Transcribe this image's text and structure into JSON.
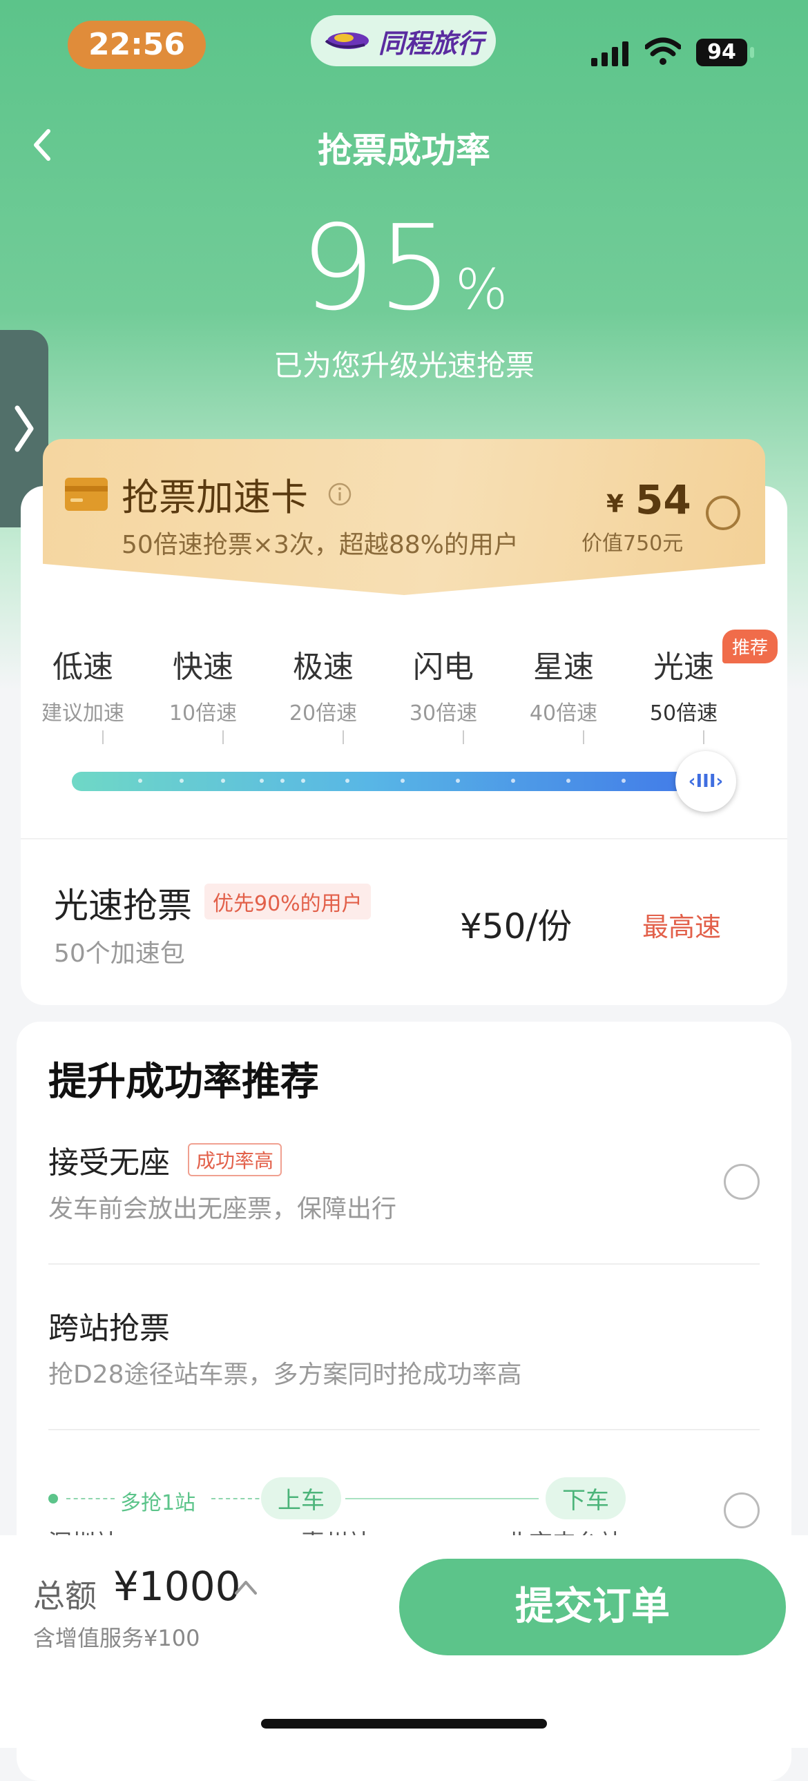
{
  "status_bar": {
    "time": "22:56",
    "battery": "94",
    "brand": "同程旅行"
  },
  "header": {
    "title": "抢票成功率"
  },
  "hero": {
    "rate_value": "95",
    "rate_unit": "%",
    "subtitle": "已为您升级光速抢票"
  },
  "accel_card": {
    "title": "抢票加速卡",
    "subtitle": "50倍速抢票×3次，超越88%的用户",
    "currency": "¥",
    "price": "54",
    "worth": "价值750元",
    "selected": false
  },
  "speed_levels": {
    "badge": "推荐",
    "items": [
      {
        "name": "低速",
        "multiplier": "建议加速"
      },
      {
        "name": "快速",
        "multiplier": "10倍速"
      },
      {
        "name": "极速",
        "multiplier": "20倍速"
      },
      {
        "name": "闪电",
        "multiplier": "30倍速"
      },
      {
        "name": "星速",
        "multiplier": "40倍速"
      },
      {
        "name": "光速",
        "multiplier": "50倍速"
      }
    ],
    "selected_index": 5,
    "slider_knob_label": "‹III›"
  },
  "selected_plan": {
    "title": "光速抢票",
    "tag": "优先90%的用户",
    "subtitle": "50个加速包",
    "price": "¥50/份",
    "speed_label": "最高速"
  },
  "recommendations": {
    "title": "提升成功率推荐",
    "options": [
      {
        "title": "接受无座",
        "tag": "成功率高",
        "subtitle": "发车前会放出无座票，保障出行",
        "selected": false
      },
      {
        "title": "跨站抢票",
        "subtitle": "抢D28途径站车票，多方案同时抢成功率高"
      }
    ],
    "route": {
      "extra_label": "多抢1站",
      "board_label": "上车",
      "alight_label": "下车",
      "stations": [
        "深圳站",
        "惠州站",
        "北京丰台站"
      ]
    }
  },
  "footer": {
    "total_label": "总额",
    "total_amount": "¥1000",
    "note": "含增值服务¥100",
    "submit_label": "提交订单"
  },
  "colors": {
    "primary_green": "#5cc48a",
    "accent_red": "#e2604a",
    "gold": "#f5d6a0"
  }
}
